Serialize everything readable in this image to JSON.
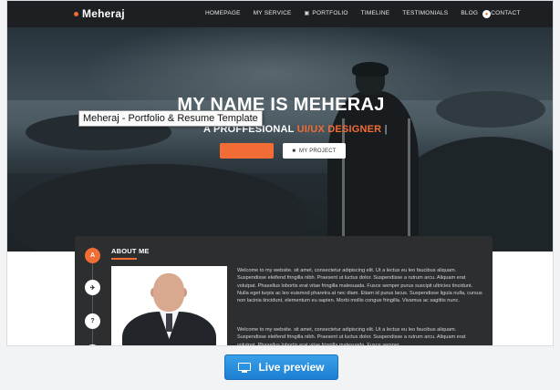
{
  "nav": {
    "logo": "Meheraj",
    "items": [
      {
        "label": "HOMEPAGE"
      },
      {
        "label": "MY SERVICE"
      },
      {
        "label": "PORTFOLIO"
      },
      {
        "label": "TIMELINE"
      },
      {
        "label": "TESTIMONIALS"
      },
      {
        "label": "BLOG"
      },
      {
        "label": "CONTACT"
      }
    ],
    "search_icon": "search-icon",
    "portfolio_icon": "camera-icon"
  },
  "hero": {
    "title": "MY NAME IS MEHERAJ",
    "subtitle_prefix": "A PROFFESIONAL",
    "subtitle_accent": "UI/UX DESIGNER",
    "cursor": "|",
    "project_button": "MY PROJECT",
    "project_icon": "briefcase-icon"
  },
  "tooltip": "Meheraj - Portfolio & Resume Template",
  "about": {
    "title": "ABOUT ME",
    "timeline_icons": [
      "user-icon",
      "rocket-icon",
      "question-icon"
    ],
    "timeline_glyphs": [
      "A",
      "✈",
      "?"
    ],
    "paragraph_1": "Welcome to my website. sit amet, consectetur adipiscing elit. Ut a lectus eu leo faucibus aliquam. Suspendisse eleifend fringilla nibh. Praesent ut luctus dolor. Suspendisse a rutrum arcu. Aliquam erat volutpat. Phasellus lobortis erat vitae fringilla malesuada. Fusce semper purus suscipit ultricies tincidunt. Nulla eget turpis ac leo euismod pharetra at nec diam. Etiam id purus lacus. Suspendisse ligula nulla, cursus non lacinia tincidunt, elementum eu sapien. Morbi mollis congue fringilla. Vivamus ac sagittis nunc.",
    "paragraph_2": "Welcome to my website. sit amet, consectetur adipiscing elit. Ut a lectus eu leo faucibus aliquam. Suspendisse eleifend fringilla nibh. Praesent ut luctus dolor. Suspendisse a rutrum arcu. Aliquam erat volutpat. Phasellus lobortis erat vitae fringilla malesuada. Fusce semper"
  },
  "live_preview": {
    "label": "Live preview",
    "icon": "monitor-icon"
  },
  "colors": {
    "accent": "#f26c35",
    "nav_bg": "#1d1f22",
    "about_bg": "#2c2e30",
    "button_blue": "#1c7fd3"
  }
}
